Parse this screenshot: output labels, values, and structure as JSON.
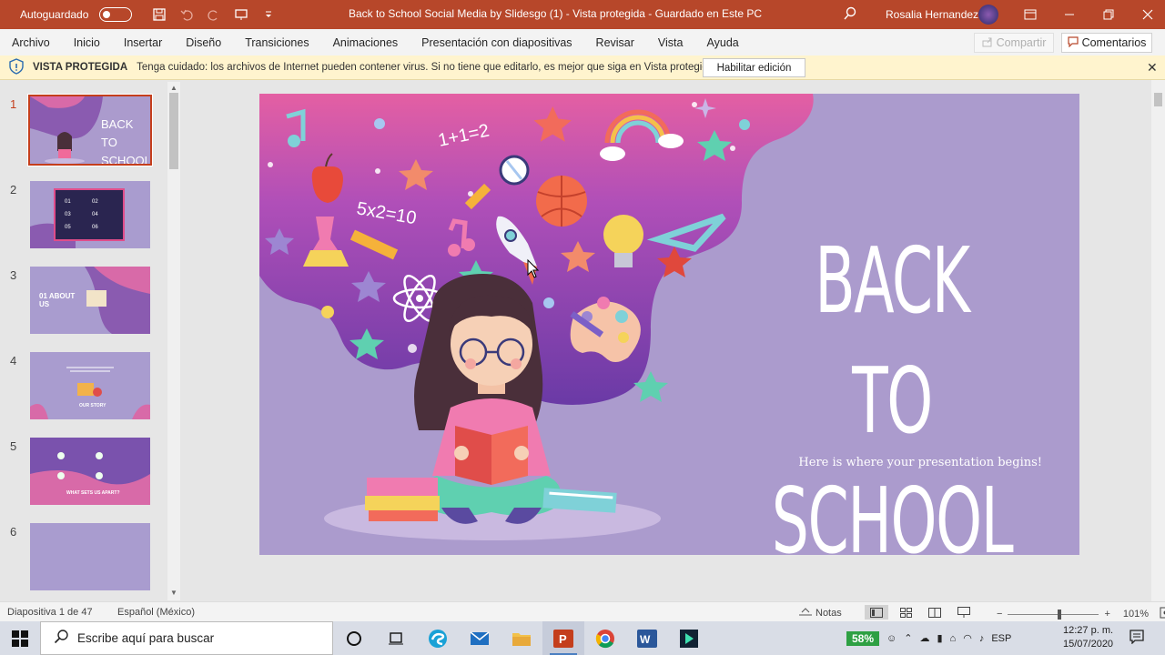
{
  "titlebar": {
    "autosave_label": "Autoguardado",
    "title": "Back to School Social Media by Slidesgo (1)  -  Vista protegida  -  Guardado en Este PC",
    "user": "Rosalia Hernandez"
  },
  "menu": [
    "Archivo",
    "Inicio",
    "Insertar",
    "Diseño",
    "Transiciones",
    "Animaciones",
    "Presentación con diapositivas",
    "Revisar",
    "Vista",
    "Ayuda"
  ],
  "share_label": "Compartir",
  "comments_label": "Comentarios",
  "protected_view": {
    "label": "VISTA PROTEGIDA",
    "message": "Tenga cuidado: los archivos de Internet pueden contener virus. Si no tiene que editarlo, es mejor que siga en Vista protegida.",
    "enable_button": "Habilitar edición"
  },
  "thumbnails": [
    {
      "num": "1",
      "text": "BACK TO SCHOOL"
    },
    {
      "num": "2",
      "text": ""
    },
    {
      "num": "3",
      "text": "01 ABOUT US"
    },
    {
      "num": "4",
      "text": "OUR STORY"
    },
    {
      "num": "5",
      "text": "WHAT SETS US APART?"
    },
    {
      "num": "6",
      "text": ""
    }
  ],
  "slide": {
    "title_line1": "BACK TO",
    "title_line2": "SCHOOL",
    "subtitle": "Here is where your presentation begins!",
    "math1": "1+1=2",
    "math2": "5x2=10"
  },
  "status": {
    "slide_info": "Diapositiva 1 de 47",
    "language": "Español (México)",
    "notes": "Notas",
    "zoom": "101%"
  },
  "taskbar": {
    "search_placeholder": "Escribe aquí para buscar",
    "battery": "58%",
    "lang": "ESP",
    "time": "12:27 p. m.",
    "date": "15/07/2020"
  },
  "colors": {
    "accent": "#b7472a",
    "slide_bg": "#ab9bcd",
    "highlight": "#c43e1c"
  }
}
